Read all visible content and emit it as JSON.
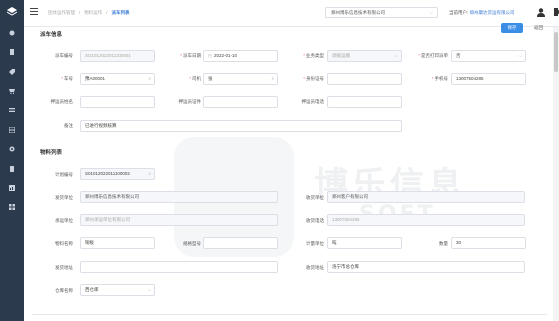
{
  "topbar": {
    "breadcrumb": [
      "团体运作管理",
      "/",
      "物料运作",
      "/",
      "派车列表"
    ],
    "company_select": "郑州博乐信息技术有限公司",
    "current_user_label": "当前用户:",
    "current_user_value": "郑州康达货运有限公司"
  },
  "sidebar": {
    "icons": [
      "layers-icon",
      "dashboard-icon",
      "document-icon",
      "tag-icon",
      "cart-icon",
      "transfer-icon",
      "table-icon",
      "gear-icon",
      "file-icon",
      "report-icon",
      "grid-icon"
    ]
  },
  "form": {
    "section1_title": "派车信息",
    "save": "保存",
    "return": "返回",
    "dispatch_no_label": "派车编号",
    "dispatch_no": "SO1012022011100001",
    "dispatch_date_label": "派车日期",
    "dispatch_date": "2022-01-10",
    "biz_type_label": "业务类型",
    "biz_type": "调拨运输",
    "is_print_label": "是否打印派单",
    "is_print": "否",
    "plate_label": "车号",
    "plate": "豫A00001",
    "driver_label": "司机",
    "driver": "张",
    "id_card_label": "身份证号",
    "id_card": "",
    "phone_label": "手机号",
    "phone": "13007504285",
    "escort_name_label": "押运员姓名",
    "escort_id_label": "押运员证件",
    "escort_phone_label": "押运员电话",
    "remark_label": "备注",
    "remark": "已进行视频核算",
    "section2_title": "物料列表",
    "plan_no_label": "计划编号",
    "plan_no": "S01012022011100002",
    "ship_unit_label": "发货单位",
    "ship_unit": "郑州博乐信息技术有限公司",
    "recv_unit_label": "收货单位",
    "recv_unit": "郑州客户有限公司",
    "carrier_label": "承运单位",
    "carrier": "郑州承运单位有限公司",
    "recv_phone_label": "收货电话",
    "recv_phone": "13007504285",
    "material_label": "物料名称",
    "material": "铜板",
    "spec_label": "规格型号",
    "unit_label": "计量单位",
    "unit": "吨",
    "qty_label": "数量",
    "qty": "30",
    "ship_addr_label": "发货地址",
    "recv_addr_label": "收货地址",
    "recv_addr": "洛宁市总仓库",
    "warehouse_label": "仓库名称",
    "warehouse": "西仓库"
  },
  "watermark": {
    "text": "博乐信息",
    "soft": "SOFT"
  }
}
